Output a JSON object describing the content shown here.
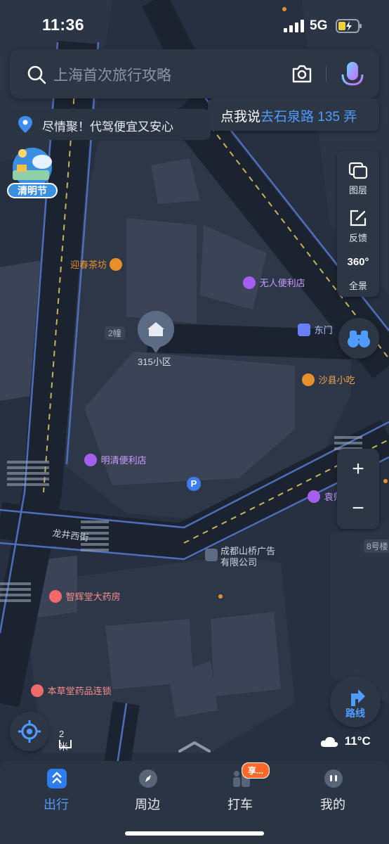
{
  "status_bar": {
    "time": "11:36",
    "network": "5G"
  },
  "search": {
    "placeholder": "上海首次旅行攻略"
  },
  "promo_banner": {
    "text": "尽情聚！代驾便宜又安心"
  },
  "voice_tip": {
    "prefix": "点我说",
    "highlight": "去石泉路 135 弄"
  },
  "festival_badge": {
    "label": "清明节"
  },
  "map_tools": [
    {
      "label": "图层",
      "icon": "layers-icon"
    },
    {
      "label": "反馈",
      "icon": "feedback-icon"
    },
    {
      "label": "全景",
      "icon": "panorama-360-icon",
      "icon_text": "360°"
    }
  ],
  "zoom": {
    "in": "+",
    "out": "−"
  },
  "route_button": {
    "label": "路线"
  },
  "scale": {
    "label": "2米"
  },
  "weather": {
    "temp": "11°C"
  },
  "pois": [
    {
      "name": "迎春茶坊",
      "type": "tea",
      "color": "#e8902a"
    },
    {
      "name": "无人便利店",
      "type": "shop",
      "color": "#a45ff0"
    },
    {
      "name": "东门",
      "type": "gate",
      "color": "#6a7ef5"
    },
    {
      "name": "沙县小吃",
      "type": "food",
      "color": "#e8902a"
    },
    {
      "name": "315小区",
      "type": "residence",
      "color": "#d7dce5"
    },
    {
      "name": "2幢",
      "type": "building",
      "color": "#aab2c0"
    },
    {
      "name": "明清便利店",
      "type": "shop",
      "color": "#a45ff0"
    },
    {
      "name": "P",
      "type": "parking",
      "color": "#3f7cf2"
    },
    {
      "name": "袁师",
      "type": "food",
      "color": "#a45ff0"
    },
    {
      "name": "成都山桥广告有限公司",
      "type": "company",
      "color": "#aab2c0"
    },
    {
      "name": "8号楼",
      "type": "building",
      "color": "#aab2c0"
    },
    {
      "name": "智辉堂大药房",
      "type": "pharmacy",
      "color": "#f06a6a"
    },
    {
      "name": "本草堂药品连锁",
      "type": "pharmacy",
      "color": "#f06a6a"
    }
  ],
  "road_labels": {
    "longjing": "龙井西街"
  },
  "bottom_nav": [
    {
      "label": "出行",
      "icon": "travel-icon",
      "active": true
    },
    {
      "label": "周边",
      "icon": "compass-icon",
      "active": false
    },
    {
      "label": "打车",
      "icon": "taxi-icon",
      "active": false,
      "badge": "享..."
    },
    {
      "label": "我的",
      "icon": "profile-icon",
      "active": false
    }
  ]
}
